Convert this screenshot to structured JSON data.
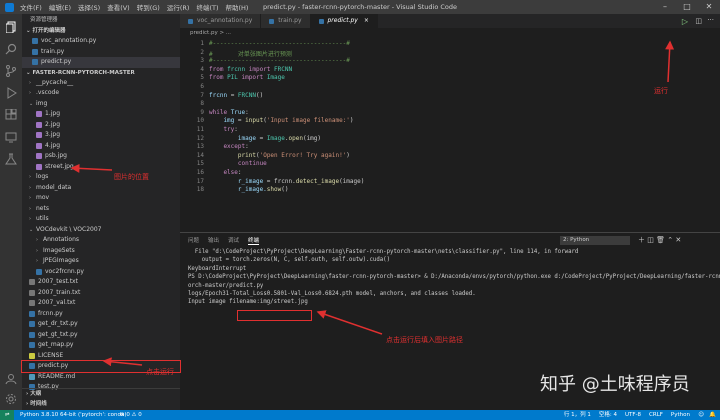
{
  "window": {
    "title": "predict.py - faster-rcnn-pytorch-master - Visual Studio Code"
  },
  "menu": [
    "文件(F)",
    "编辑(E)",
    "选择(S)",
    "查看(V)",
    "转到(G)",
    "运行(R)",
    "终端(T)",
    "帮助(H)"
  ],
  "sidebar": {
    "header": "资源管理器",
    "open_editors_title": "打开的编辑器",
    "open_editors": [
      "voc_annotation.py",
      "train.py",
      "predict.py"
    ],
    "folder_title": "FASTER-RCNN-PYTORCH-MASTER",
    "tree": [
      {
        "label": "__pycache__",
        "type": "folder",
        "depth": 1
      },
      {
        "label": ".vscode",
        "type": "folder",
        "depth": 1
      },
      {
        "label": "img",
        "type": "folder-open",
        "depth": 1
      },
      {
        "label": "1.jpg",
        "type": "image",
        "depth": 2
      },
      {
        "label": "2.jpg",
        "type": "image",
        "depth": 2
      },
      {
        "label": "3.jpg",
        "type": "image",
        "depth": 2
      },
      {
        "label": "4.jpg",
        "type": "image",
        "depth": 2
      },
      {
        "label": "psb.jpg",
        "type": "image",
        "depth": 2
      },
      {
        "label": "street.jpg",
        "type": "image",
        "depth": 2
      },
      {
        "label": "logs",
        "type": "folder",
        "depth": 1
      },
      {
        "label": "model_data",
        "type": "folder",
        "depth": 1
      },
      {
        "label": "mov",
        "type": "folder",
        "depth": 1
      },
      {
        "label": "nets",
        "type": "folder",
        "depth": 1
      },
      {
        "label": "utils",
        "type": "folder",
        "depth": 1
      },
      {
        "label": "VOCdevkit \\ VOC2007",
        "type": "folder-open",
        "depth": 1
      },
      {
        "label": "Annotations",
        "type": "folder",
        "depth": 2
      },
      {
        "label": "ImageSets",
        "type": "folder",
        "depth": 2
      },
      {
        "label": "JPEGImages",
        "type": "folder",
        "depth": 2
      },
      {
        "label": "voc2frcnn.py",
        "type": "py",
        "depth": 2
      },
      {
        "label": "2007_test.txt",
        "type": "txt",
        "depth": 1
      },
      {
        "label": "2007_train.txt",
        "type": "txt",
        "depth": 1
      },
      {
        "label": "2007_val.txt",
        "type": "txt",
        "depth": 1
      },
      {
        "label": "frcnn.py",
        "type": "py",
        "depth": 1
      },
      {
        "label": "get_dr_txt.py",
        "type": "py",
        "depth": 1
      },
      {
        "label": "get_gt_txt.py",
        "type": "py",
        "depth": 1
      },
      {
        "label": "get_map.py",
        "type": "py",
        "depth": 1
      },
      {
        "label": "LICENSE",
        "type": "license",
        "depth": 1
      },
      {
        "label": "predict.py",
        "type": "py",
        "depth": 1
      },
      {
        "label": "README.md",
        "type": "md",
        "depth": 1
      },
      {
        "label": "test.py",
        "type": "py",
        "depth": 1
      }
    ],
    "outline_title": "大纲",
    "timeline_title": "时间线"
  },
  "tabs": [
    {
      "label": "voc_annotation.py"
    },
    {
      "label": "train.py"
    },
    {
      "label": "predict.py",
      "active": true
    }
  ],
  "breadcrumb": "predict.py > ...",
  "editor": {
    "lines": [
      [
        {
          "t": "#-------------------------------------#",
          "c": "cm"
        }
      ],
      [
        {
          "t": "#       对单张图片进行预测",
          "c": "cm"
        }
      ],
      [
        {
          "t": "#-------------------------------------#",
          "c": "cm"
        }
      ],
      [
        {
          "t": "from ",
          "c": "kw"
        },
        {
          "t": "frcnn ",
          "c": "bu"
        },
        {
          "t": "import ",
          "c": "kw"
        },
        {
          "t": "FRCNN",
          "c": "bu"
        }
      ],
      [
        {
          "t": "from ",
          "c": "kw"
        },
        {
          "t": "PIL ",
          "c": "bu"
        },
        {
          "t": "import ",
          "c": "kw"
        },
        {
          "t": "Image",
          "c": "bu"
        }
      ],
      [],
      [
        {
          "t": "frcnn ",
          "c": "vr"
        },
        {
          "t": "= ",
          "c": ""
        },
        {
          "t": "FRCNN",
          "c": "bu"
        },
        {
          "t": "()",
          "c": ""
        }
      ],
      [],
      [
        {
          "t": "while ",
          "c": "kw"
        },
        {
          "t": "True",
          "c": "vr"
        },
        {
          "t": ":",
          "c": ""
        }
      ],
      [
        {
          "t": "    img ",
          "c": "vr"
        },
        {
          "t": "= ",
          "c": ""
        },
        {
          "t": "input",
          "c": "fn"
        },
        {
          "t": "(",
          "c": ""
        },
        {
          "t": "'Input image filename:'",
          "c": "st"
        },
        {
          "t": ")",
          "c": ""
        }
      ],
      [
        {
          "t": "    try",
          "c": "kw"
        },
        {
          "t": ":",
          "c": ""
        }
      ],
      [
        {
          "t": "        image ",
          "c": "vr"
        },
        {
          "t": "= ",
          "c": ""
        },
        {
          "t": "Image",
          "c": "bu"
        },
        {
          "t": ".",
          "c": ""
        },
        {
          "t": "open",
          "c": "fn"
        },
        {
          "t": "(img)",
          "c": ""
        }
      ],
      [
        {
          "t": "    except",
          "c": "kw"
        },
        {
          "t": ":",
          "c": ""
        }
      ],
      [
        {
          "t": "        print",
          "c": "fn"
        },
        {
          "t": "(",
          "c": ""
        },
        {
          "t": "'Open Error! Try again!'",
          "c": "st"
        },
        {
          "t": ")",
          "c": ""
        }
      ],
      [
        {
          "t": "        continue",
          "c": "kw"
        }
      ],
      [
        {
          "t": "    else",
          "c": "kw"
        },
        {
          "t": ":",
          "c": ""
        }
      ],
      [
        {
          "t": "        r_image ",
          "c": "vr"
        },
        {
          "t": "= frcnn.",
          "c": ""
        },
        {
          "t": "detect_image",
          "c": "fn"
        },
        {
          "t": "(image)",
          "c": ""
        }
      ],
      [
        {
          "t": "        r_image.",
          "c": "vr"
        },
        {
          "t": "show",
          "c": "fn"
        },
        {
          "t": "()",
          "c": ""
        }
      ]
    ]
  },
  "panel": {
    "tabs": [
      "问题",
      "输出",
      "调试",
      "终端"
    ],
    "active_tab": "终端",
    "terminal_select": "2: Python",
    "lines": [
      "  File \"d:\\CodeProject\\PyProject\\DeepLearning\\Faster-rcnn-pytorch-master\\nets\\classifier.py\", line 114, in forward",
      "    output = torch.zeros(N, C, self.outh, self.outw).cuda()",
      "KeyboardInterrupt",
      "PS D:\\CodeProject\\PyProject\\DeepLearning\\faster-rcnn-pytorch-master> & D:/Anaconda/envs/pytorch/python.exe d:/CodeProject/PyProject/DeepLearning/faster-rcnn-pyt",
      "orch-master/predict.py",
      "logs/Epoch31-Total_Loss0.5801-Val_Loss0.6824.pth model, anchors, and classes loaded.",
      "Input image filename:img/street.jpg"
    ]
  },
  "status": {
    "left": "Python 3.8.10 64-bit ('pytorch': conda)",
    "problems": "⊗ 0 ⚠ 0",
    "right": [
      "行 1，列 1",
      "空格: 4",
      "UTF-8",
      "CRLF",
      "Python"
    ]
  },
  "annotations": {
    "image_location": "图片的位置",
    "run": "运行",
    "click_run": "点击运行",
    "enter_path": "点击运行后填入图片路径"
  },
  "watermark": "知乎 @土味程序员"
}
